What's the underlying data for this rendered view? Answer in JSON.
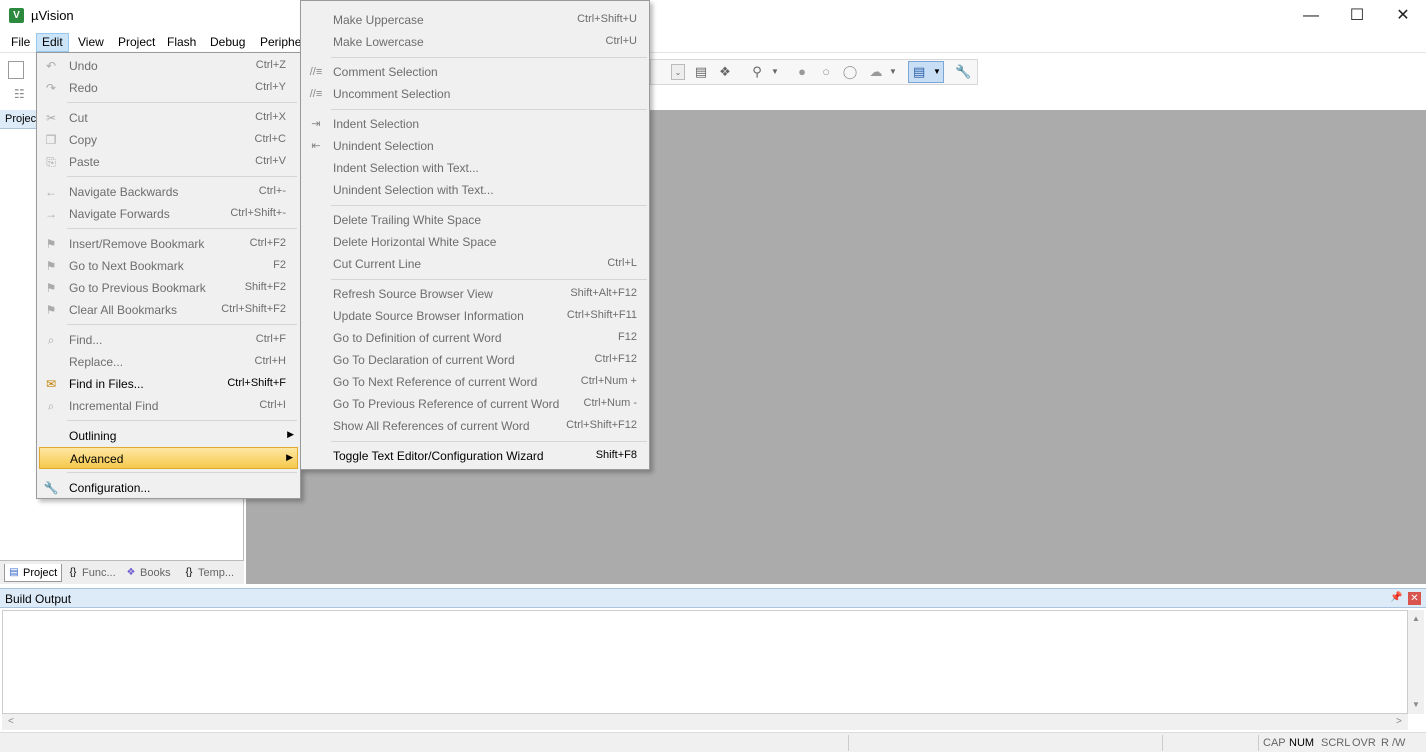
{
  "window": {
    "title": "µVision",
    "app_icon_glyph": "V"
  },
  "menubar": {
    "items": [
      "File",
      "Edit",
      "View",
      "Project",
      "Flash",
      "Debug",
      "Periphe"
    ]
  },
  "project_panel": {
    "header": "Projec",
    "tabs": [
      "Project",
      "Func...",
      "Books",
      "Temp..."
    ]
  },
  "edit_menu": {
    "items": [
      {
        "label": "Undo",
        "shortcut": "Ctrl+Z",
        "icon": "undo-icon",
        "glyph": "↶"
      },
      {
        "label": "Redo",
        "shortcut": "Ctrl+Y",
        "icon": "redo-icon",
        "glyph": "↷"
      },
      {
        "label": "Cut",
        "shortcut": "Ctrl+X",
        "icon": "cut-icon",
        "glyph": "✂"
      },
      {
        "label": "Copy",
        "shortcut": "Ctrl+C",
        "icon": "copy-icon",
        "glyph": "❐"
      },
      {
        "label": "Paste",
        "shortcut": "Ctrl+V",
        "icon": "paste-icon",
        "glyph": "⎘"
      },
      {
        "label": "Navigate Backwards",
        "shortcut": "Ctrl+-",
        "icon": "arrow-left-icon",
        "glyph": "←"
      },
      {
        "label": "Navigate Forwards",
        "shortcut": "Ctrl+Shift+-",
        "icon": "arrow-right-icon",
        "glyph": "→"
      },
      {
        "label": "Insert/Remove Bookmark",
        "shortcut": "Ctrl+F2",
        "icon": "bookmark-icon",
        "glyph": "⚑"
      },
      {
        "label": "Go to Next Bookmark",
        "shortcut": "F2",
        "icon": "next-bookmark-icon",
        "glyph": "⚑"
      },
      {
        "label": "Go to Previous Bookmark",
        "shortcut": "Shift+F2",
        "icon": "prev-bookmark-icon",
        "glyph": "⚑"
      },
      {
        "label": "Clear All Bookmarks",
        "shortcut": "Ctrl+Shift+F2",
        "icon": "clear-bookmarks-icon",
        "glyph": "⚑"
      },
      {
        "label": "Find...",
        "shortcut": "Ctrl+F",
        "icon": "find-icon",
        "glyph": "⌕"
      },
      {
        "label": "Replace...",
        "shortcut": "Ctrl+H",
        "icon": "",
        "glyph": ""
      },
      {
        "label": "Find in Files...",
        "shortcut": "Ctrl+Shift+F",
        "icon": "find-in-files-icon",
        "glyph": "✉"
      },
      {
        "label": "Incremental Find",
        "shortcut": "Ctrl+I",
        "icon": "incremental-find-icon",
        "glyph": "⌕"
      },
      {
        "label": "Outlining",
        "shortcut": "",
        "icon": "",
        "glyph": ""
      },
      {
        "label": "Advanced",
        "shortcut": "",
        "icon": "",
        "glyph": ""
      },
      {
        "label": "Configuration...",
        "shortcut": "",
        "icon": "wrench-icon",
        "glyph": "🔧"
      }
    ]
  },
  "advanced_menu": {
    "items": [
      {
        "label": "Make Uppercase",
        "shortcut": "Ctrl+Shift+U",
        "glyph": ""
      },
      {
        "label": "Make Lowercase",
        "shortcut": "Ctrl+U",
        "glyph": ""
      },
      {
        "label": "Comment Selection",
        "shortcut": "",
        "glyph": "//≡"
      },
      {
        "label": "Uncomment Selection",
        "shortcut": "",
        "glyph": "//≡"
      },
      {
        "label": "Indent Selection",
        "shortcut": "",
        "glyph": "⇥"
      },
      {
        "label": "Unindent Selection",
        "shortcut": "",
        "glyph": "⇤"
      },
      {
        "label": "Indent Selection with Text...",
        "shortcut": "",
        "glyph": ""
      },
      {
        "label": "Unindent Selection with Text...",
        "shortcut": "",
        "glyph": ""
      },
      {
        "label": "Delete Trailing White Space",
        "shortcut": "",
        "glyph": ""
      },
      {
        "label": "Delete Horizontal White Space",
        "shortcut": "",
        "glyph": ""
      },
      {
        "label": "Cut Current Line",
        "shortcut": "Ctrl+L",
        "glyph": ""
      },
      {
        "label": "Refresh Source Browser View",
        "shortcut": "Shift+Alt+F12",
        "glyph": ""
      },
      {
        "label": "Update Source Browser Information",
        "shortcut": "Ctrl+Shift+F11",
        "glyph": ""
      },
      {
        "label": "Go to Definition of current Word",
        "shortcut": "F12",
        "glyph": ""
      },
      {
        "label": "Go To Declaration of current Word",
        "shortcut": "Ctrl+F12",
        "glyph": ""
      },
      {
        "label": "Go To Next Reference of current Word",
        "shortcut": "Ctrl+Num +",
        "glyph": ""
      },
      {
        "label": "Go To Previous Reference of current Word",
        "shortcut": "Ctrl+Num -",
        "glyph": ""
      },
      {
        "label": "Show All References of current Word",
        "shortcut": "Ctrl+Shift+F12",
        "glyph": ""
      },
      {
        "label": "Toggle Text Editor/Configuration Wizard",
        "shortcut": "Shift+F8",
        "glyph": ""
      }
    ]
  },
  "build_output": {
    "title": "Build Output"
  },
  "statusbar": {
    "items": [
      "CAP",
      "NUM",
      "SCRL",
      "OVR",
      "R /W"
    ]
  },
  "theme": {
    "highlight": "#f6c94c",
    "editor_bg": "#ababab",
    "panel_header": "#ddeaf7"
  }
}
